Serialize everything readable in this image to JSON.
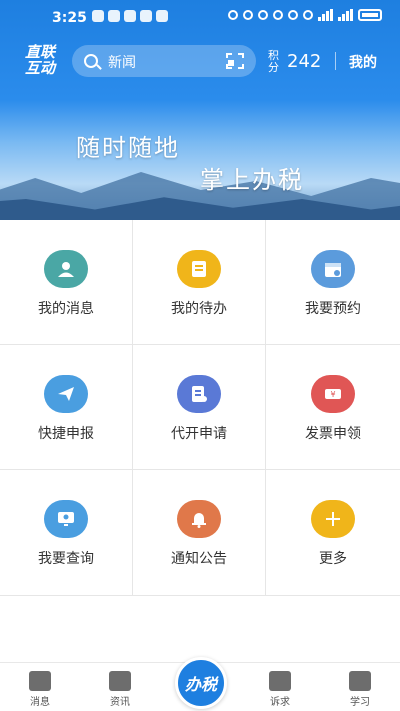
{
  "status": {
    "time": "3:25"
  },
  "header": {
    "logo_line1": "直联",
    "logo_line2": "互动",
    "search_placeholder": "新闻",
    "points_label": "积分",
    "points_value": "242",
    "mine_label": "我的"
  },
  "banner": {
    "line1": "随时随地",
    "line2": "掌上办税"
  },
  "grid": [
    {
      "label": "我的消息",
      "icon": "user-icon",
      "color": "#4aa7a5"
    },
    {
      "label": "我的待办",
      "icon": "todo-icon",
      "color": "#f0b51a"
    },
    {
      "label": "我要预约",
      "icon": "calendar-icon",
      "color": "#5b9bdc"
    },
    {
      "label": "快捷申报",
      "icon": "paper-plane-icon",
      "color": "#4a9ee0"
    },
    {
      "label": "代开申请",
      "icon": "document-edit-icon",
      "color": "#5a79d6"
    },
    {
      "label": "发票申领",
      "icon": "ticket-icon",
      "color": "#e05655"
    },
    {
      "label": "我要查询",
      "icon": "monitor-icon",
      "color": "#4a9ee0"
    },
    {
      "label": "通知公告",
      "icon": "bell-icon",
      "color": "#e0784a"
    },
    {
      "label": "更多",
      "icon": "plus-icon",
      "color": "#f0b51a"
    }
  ],
  "bottom_nav": {
    "items": [
      {
        "label": "消息",
        "icon": "message-icon"
      },
      {
        "label": "资讯",
        "icon": "news-icon"
      },
      {
        "label": "诉求",
        "icon": "edit-icon"
      },
      {
        "label": "学习",
        "icon": "book-icon"
      }
    ],
    "center_label": "办税"
  }
}
